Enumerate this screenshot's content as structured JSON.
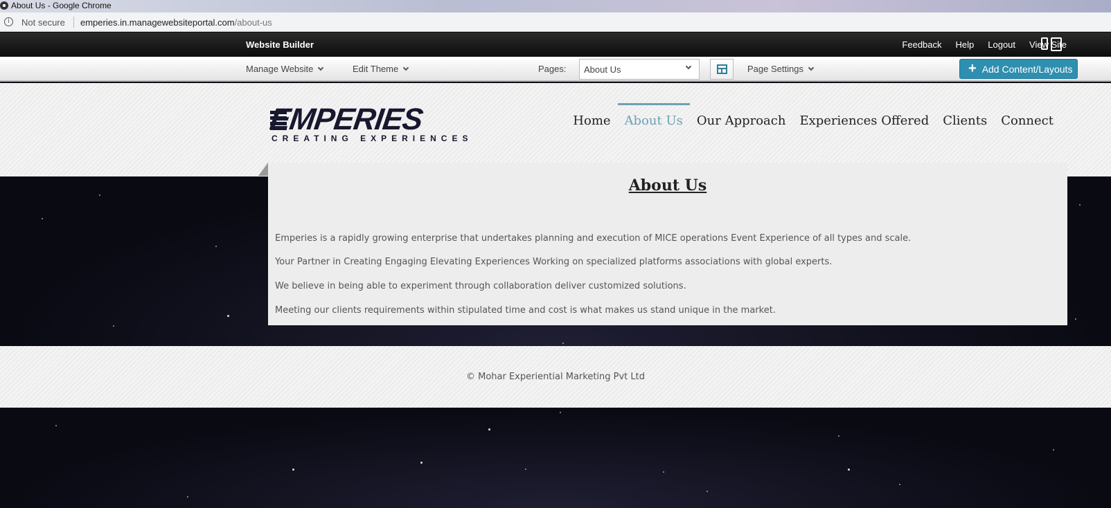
{
  "browser": {
    "window_title": "About Us - Google Chrome",
    "security_label": "Not secure",
    "url_host": "emperies.in.managewebsiteportal.com",
    "url_path": "/about-us"
  },
  "builder": {
    "brand": "Website Builder",
    "top_links": [
      "Feedback",
      "Help",
      "Logout",
      "View Site"
    ],
    "manage_website": "Manage Website",
    "edit_theme": "Edit Theme",
    "pages_label": "Pages:",
    "pages_selected": "About Us",
    "page_settings": "Page Settings",
    "add_content": "Add Content/Layouts",
    "accent_color": "#2e8fb0"
  },
  "site": {
    "logo_word": "EMPERIES",
    "logo_tagline": "CREATING EXPERIENCES",
    "nav": [
      "Home",
      "About Us",
      "Our Approach",
      "Experiences Offered",
      "Clients",
      "Connect"
    ],
    "active_nav": "About Us",
    "active_color": "#6ea1b4",
    "page_title": "About Us",
    "paragraphs": [
      "Emperies is a rapidly growing enterprise that undertakes planning and execution of MICE operations Event Experience of all types and scale.",
      "Your Partner in Creating Engaging Elevating Experiences Working on specialized platforms associations with global experts.",
      "We believe in being able to experiment through collaboration deliver customized solutions.",
      "Meeting our clients requirements within stipulated time and cost is what makes us stand unique in the market."
    ],
    "footer": "© Mohar Experiential Marketing Pvt Ltd"
  }
}
